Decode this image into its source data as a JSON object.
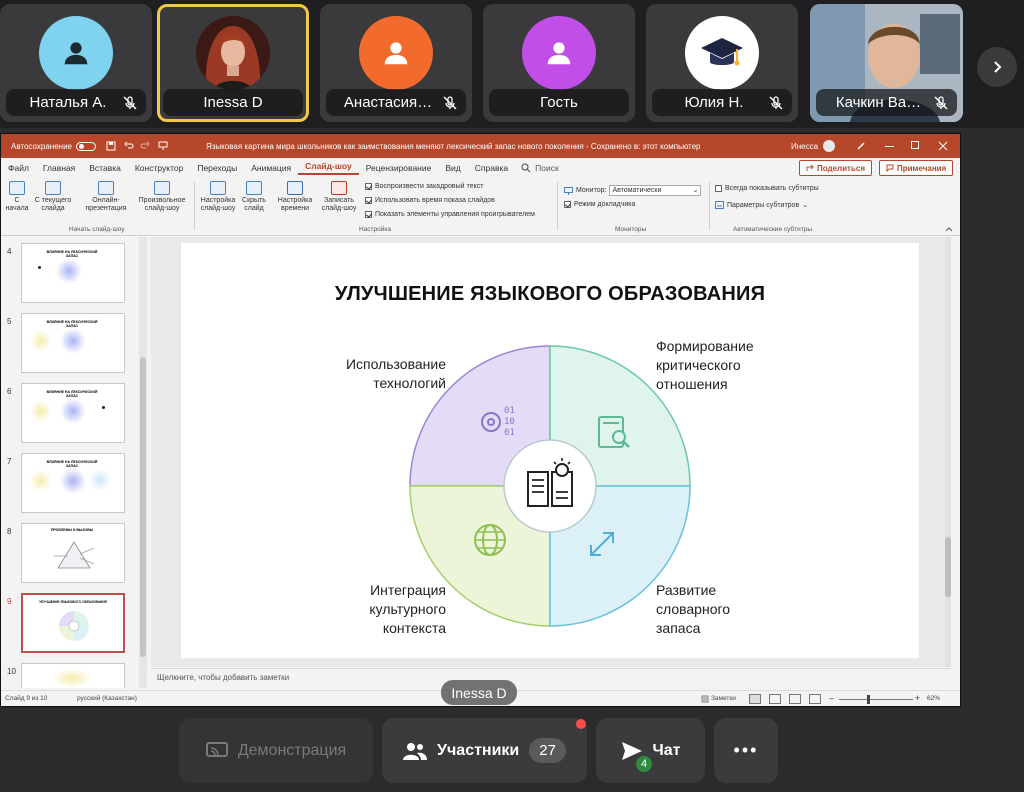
{
  "participants": [
    {
      "name": "Наталья А.",
      "avatar_color": "#7fd3ee",
      "muted": true
    },
    {
      "name": "Inessa D",
      "avatar_color": "#5a2a22",
      "muted": false,
      "speaking": true
    },
    {
      "name": "Анастасия…",
      "avatar_color": "#f26b2d",
      "muted": true
    },
    {
      "name": "Гость",
      "avatar_color": "#c24ee8",
      "muted": false
    },
    {
      "name": "Юлия Н.",
      "avatar_color": "#ffffff",
      "avatar_icon": "graduation-cap-icon",
      "muted": true
    },
    {
      "name": "Качкин Ва…",
      "video": true,
      "muted": true
    }
  ],
  "powerpoint": {
    "autosave_label": "Автосохранение",
    "window_title": "Языковая картина мира школьников как заимствования меняют лексический запас нового поколения  -  Сохранено в: этот компьютер",
    "search_placeholder": "Поиск",
    "user": "Инесса",
    "tabs": [
      "Файл",
      "Главная",
      "Вставка",
      "Конструктор",
      "Переходы",
      "Анимация",
      "Слайд-шоу",
      "Рецензирование",
      "Вид",
      "Справка"
    ],
    "active_tab": "Слайд-шоу",
    "share_label": "Поделиться",
    "comments_label": "Примечания",
    "ribbon": {
      "start_group": {
        "buttons": [
          {
            "label": "С начала"
          },
          {
            "label": "С текущего слайда"
          },
          {
            "label": "Онлайн-презентация"
          },
          {
            "label": "Произвольное слайд-шоу"
          }
        ],
        "group_label": "Начать слайд-шоу"
      },
      "setup_group": {
        "buttons": [
          {
            "label": "Настройка слайд-шоу"
          },
          {
            "label": "Скрыть слайд"
          },
          {
            "label": "Настройка времени"
          },
          {
            "label": "Записать слайд-шоу"
          }
        ],
        "checkboxes": [
          {
            "label": "Воспроизвести закадровый текст",
            "checked": true
          },
          {
            "label": "Использовать время показа слайдов",
            "checked": true
          },
          {
            "label": "Показать элементы управления проигрывателем",
            "checked": true
          }
        ],
        "group_label": "Настройка"
      },
      "monitors_group": {
        "monitor_label": "Монитор:",
        "monitor_value": "Автоматически",
        "presenter_view_label": "Режим докладчика",
        "group_label": "Мониторы"
      },
      "subtitles_group": {
        "always_show_label": "Всегда показывать субтитры",
        "settings_label": "Параметры субтитров",
        "group_label": "Автоматические субтитры"
      }
    },
    "thumbnails": [
      {
        "num": "4",
        "title": "ВЛИЯНИЕ НА ЛЕКСИЧЕСКИЙ ЗАПАС"
      },
      {
        "num": "5",
        "title": "ВЛИЯНИЕ НА ЛЕКСИЧЕСКИЙ ЗАПАС"
      },
      {
        "num": "6",
        "title": "ВЛИЯНИЕ НА ЛЕКСИЧЕСКИЙ ЗАПАС"
      },
      {
        "num": "7",
        "title": "ВЛИЯНИЕ НА ЛЕКСИЧЕСКИЙ ЗАПАС"
      },
      {
        "num": "8",
        "title": "ПРОБЛЕМЫ И ВЫЗОВЫ"
      },
      {
        "num": "9",
        "title": "УЛУЧШЕНИЕ ЯЗЫКОВОГО ОБРАЗОВАНИЯ",
        "selected": true
      },
      {
        "num": "10",
        "title": ""
      }
    ],
    "slide": {
      "title": "УЛУЧШЕНИЕ ЯЗЫКОВОГО ОБРАЗОВАНИЯ",
      "quadrants": [
        {
          "label": "Использование технологий",
          "color": "#e4dcf7",
          "stroke": "#9b84d6",
          "icon": "binary-gear-icon"
        },
        {
          "label": "Формирование критического отношения",
          "color": "#dff5ec",
          "stroke": "#6cc7a6",
          "icon": "book-search-icon"
        },
        {
          "label": "Интеграция культурного контекста",
          "color": "#ecf5d8",
          "stroke": "#a3cf6b",
          "icon": "globe-icon"
        },
        {
          "label": "Развитие словарного запаса",
          "color": "#dcf0f7",
          "stroke": "#6cbfdc",
          "icon": "expand-arrows-icon"
        }
      ],
      "center_icon": "book-idea-icon"
    },
    "notes_placeholder": "Щелкните, чтобы добавить заметки",
    "status": {
      "slide_info": "Слайд 9 из 10",
      "language": "русский (Казахстан)",
      "notes_label": "Заметки",
      "zoom": "62%"
    }
  },
  "presenter_tag": "Inessa D",
  "controls": {
    "demo_label": "Демонстрация",
    "participants_label": "Участники",
    "participants_count": "27",
    "chat_label": "Чат",
    "chat_badge": "4",
    "more_label": "•••"
  }
}
